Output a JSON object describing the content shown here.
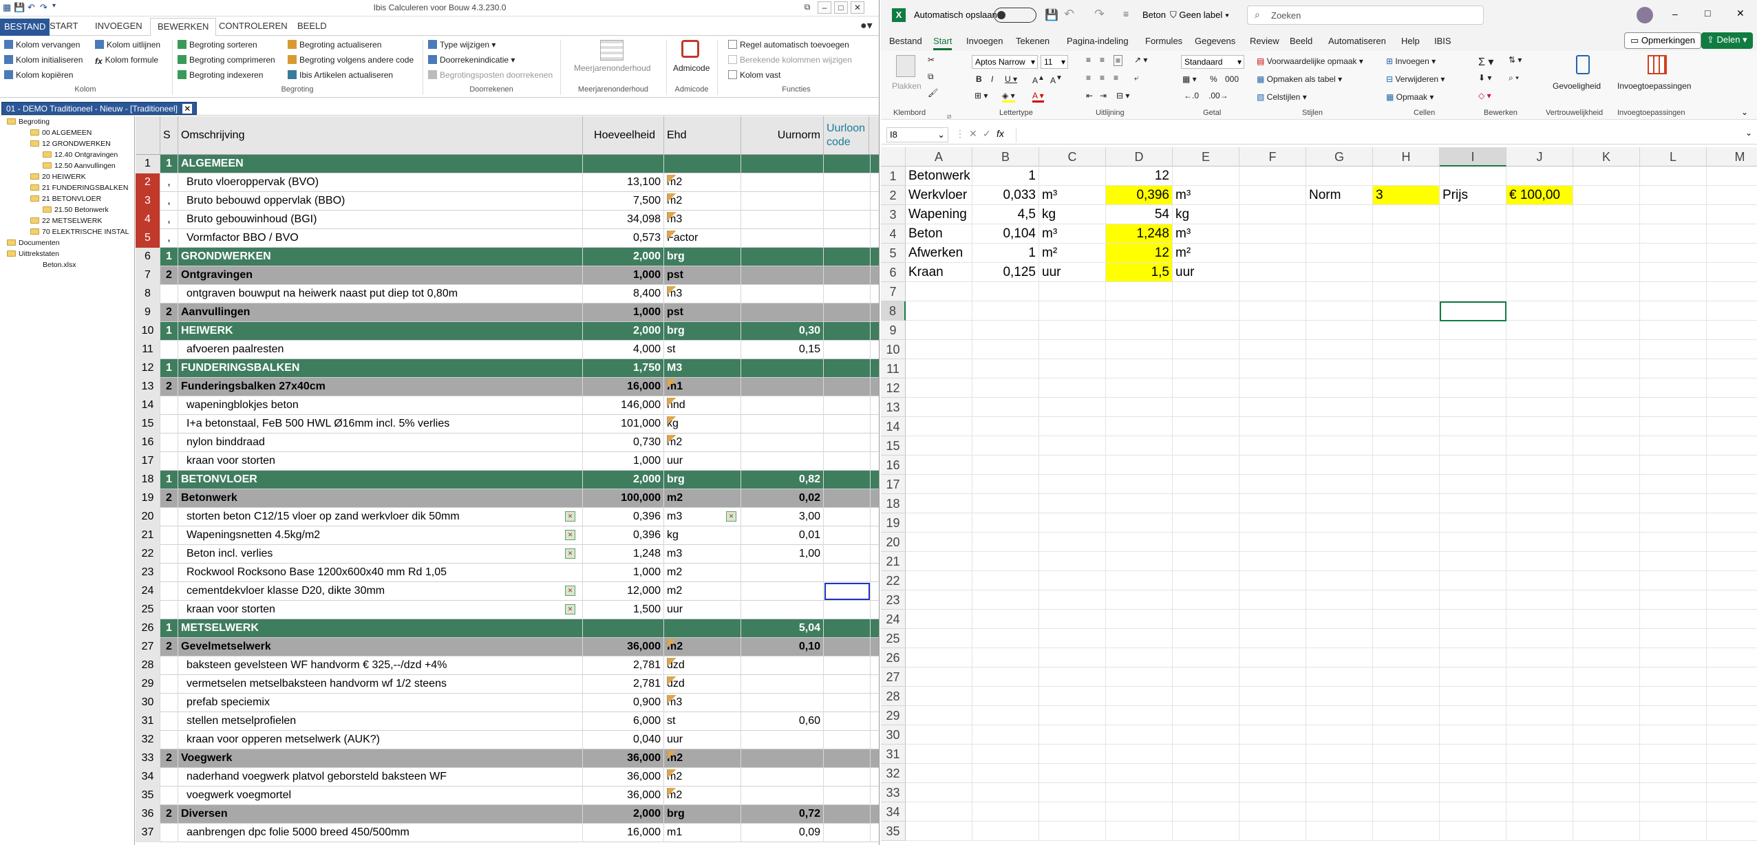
{
  "ibis": {
    "title": "Ibis Calculeren voor Bouw 4.3.230.0",
    "tabs": [
      "BESTAND",
      "START",
      "INVOEGEN",
      "BEWERKEN",
      "CONTROLEREN",
      "BEELD"
    ],
    "ribbon": {
      "kolom": [
        "Kolom vervangen",
        "Kolom initialiseren",
        "Kolom kopiëren",
        "Kolom uitlijnen",
        "Kolom formule"
      ],
      "begroting": [
        "Begroting sorteren",
        "Begroting comprimeren",
        "Begroting indexeren",
        "Begroting actualiseren",
        "Begroting volgens andere code",
        "Ibis Artikelen actualiseren"
      ],
      "doorrekenen": [
        "Type wijzigen",
        "Doorrekenindicatie",
        "Begrotingsposten doorrekenen"
      ],
      "meerjaren": "Meerjarenonderhoud",
      "admicode": "Admicode",
      "functies": [
        "Regel automatisch toevoegen",
        "Berekende kolommen wijzigen",
        "Kolom vast"
      ],
      "groups": [
        "Kolom",
        "Begroting",
        "Doorrekenen",
        "Meerjarenonderhoud",
        "Admicode",
        "Functies"
      ]
    },
    "doc_tab": "01 - DEMO Traditioneel - Nieuw - [Traditioneel]",
    "tree": [
      "Begroting",
      "00 ALGEMEEN",
      "12 GRONDWERKEN",
      "12.40 Ontgravingen",
      "12.50 Aanvullingen",
      "20 HEIWERK",
      "21 FUNDERINGSBALKEN",
      "21 BETONVLOER",
      "21.50 Betonwerk",
      "22 METSELWERK",
      "70 ELEKTRISCHE INSTAL",
      "Documenten",
      "Uittrekstaten",
      "Beton.xlsx"
    ],
    "columns": {
      "s": "S",
      "desc": "Omschrijving",
      "qty": "Hoeveelheid",
      "unit": "Ehd",
      "norm": "Uurnorm",
      "code": "Uurloon code"
    },
    "rows": [
      {
        "n": "1",
        "lvl": 1,
        "s": "1",
        "d": "ALGEMEEN",
        "q": "",
        "u": "",
        "nm": ""
      },
      {
        "n": "2",
        "lvl": 0,
        "red": true,
        "s": ",",
        "d": "Bruto vloeroppervak (BVO)",
        "q": "13,100",
        "u": "m2",
        "nm": "",
        "flag": true
      },
      {
        "n": "3",
        "lvl": 0,
        "red": true,
        "s": ",",
        "d": "Bruto bebouwd oppervlak (BBO)",
        "q": "7,500",
        "u": "m2",
        "nm": "",
        "flag": true
      },
      {
        "n": "4",
        "lvl": 0,
        "red": true,
        "s": ",",
        "d": "Bruto gebouwinhoud (BGI)",
        "q": "34,098",
        "u": "m3",
        "nm": "",
        "flag": true
      },
      {
        "n": "5",
        "lvl": 0,
        "red": true,
        "s": ",",
        "d": "Vormfactor BBO / BVO",
        "q": "0,573",
        "u": "Factor",
        "nm": "",
        "flag": true
      },
      {
        "n": "6",
        "lvl": 1,
        "s": "1",
        "d": "GRONDWERKEN",
        "q": "2,000",
        "u": "brg",
        "nm": ""
      },
      {
        "n": "7",
        "lvl": 2,
        "s": "2",
        "d": "Ontgravingen",
        "q": "1,000",
        "u": "pst",
        "nm": ""
      },
      {
        "n": "8",
        "lvl": 0,
        "s": "",
        "d": "ontgraven bouwput na heiwerk naast put diep tot 0,80m",
        "q": "8,400",
        "u": "m3",
        "nm": "",
        "flag": true
      },
      {
        "n": "9",
        "lvl": 2,
        "s": "2",
        "d": "Aanvullingen",
        "q": "1,000",
        "u": "pst",
        "nm": ""
      },
      {
        "n": "10",
        "lvl": 1,
        "s": "1",
        "d": "HEIWERK",
        "q": "2,000",
        "u": "brg",
        "nm": "0,30"
      },
      {
        "n": "11",
        "lvl": 0,
        "s": "",
        "d": "afvoeren paalresten",
        "q": "4,000",
        "u": "st",
        "nm": "0,15"
      },
      {
        "n": "12",
        "lvl": 1,
        "s": "1",
        "d": "FUNDERINGSBALKEN",
        "q": "1,750",
        "u": "M3",
        "nm": ""
      },
      {
        "n": "13",
        "lvl": 2,
        "s": "2",
        "d": "Funderingsbalken 27x40cm",
        "q": "16,000",
        "u": "m1",
        "nm": "",
        "flag": true
      },
      {
        "n": "14",
        "lvl": 0,
        "s": "",
        "d": "wapeningblokjes beton",
        "q": "146,000",
        "u": "hnd",
        "nm": "",
        "flag": true
      },
      {
        "n": "15",
        "lvl": 0,
        "s": "",
        "d": "I+a betonstaal, FeB 500 HWL Ø16mm incl. 5% verlies",
        "q": "101,000",
        "u": "kg",
        "nm": "",
        "flag": true
      },
      {
        "n": "16",
        "lvl": 0,
        "s": "",
        "d": "nylon binddraad",
        "q": "0,730",
        "u": "m2",
        "nm": "",
        "flag": true
      },
      {
        "n": "17",
        "lvl": 0,
        "s": "",
        "d": "kraan voor storten",
        "q": "1,000",
        "u": "uur",
        "nm": ""
      },
      {
        "n": "18",
        "lvl": 1,
        "s": "1",
        "d": "BETONVLOER",
        "q": "2,000",
        "u": "brg",
        "nm": "0,82"
      },
      {
        "n": "19",
        "lvl": 2,
        "s": "2",
        "d": "Betonwerk",
        "q": "100,000",
        "u": "m2",
        "nm": "0,02"
      },
      {
        "n": "20",
        "lvl": 0,
        "s": "",
        "d": "storten beton C12/15 vloer op zand werkvloer dik 50mm",
        "q": "0,396",
        "u": "m3",
        "nm": "3,00",
        "icon": true,
        "icon2": true
      },
      {
        "n": "21",
        "lvl": 0,
        "s": "",
        "d": "Wapeningsnetten 4.5kg/m2",
        "q": "0,396",
        "u": "kg",
        "nm": "0,01",
        "icon": true
      },
      {
        "n": "22",
        "lvl": 0,
        "s": "",
        "d": "Beton incl. verlies",
        "q": "1,248",
        "u": "m3",
        "nm": "1,00",
        "icon": true
      },
      {
        "n": "23",
        "lvl": 0,
        "s": "",
        "d": "Rockwool Rocksono Base 1200x600x40 mm Rd 1,05",
        "q": "1,000",
        "u": "m2",
        "nm": ""
      },
      {
        "n": "24",
        "lvl": 0,
        "s": "",
        "d": "cementdekvloer klasse D20, dikte 30mm",
        "q": "12,000",
        "u": "m2",
        "nm": "",
        "icon": true,
        "sel": true
      },
      {
        "n": "25",
        "lvl": 0,
        "s": "",
        "d": "kraan voor storten",
        "q": "1,500",
        "u": "uur",
        "nm": "",
        "icon": true
      },
      {
        "n": "26",
        "lvl": 1,
        "s": "1",
        "d": "METSELWERK",
        "q": "",
        "u": "",
        "nm": "5,04"
      },
      {
        "n": "27",
        "lvl": 2,
        "s": "2",
        "d": "Gevelmetselwerk",
        "q": "36,000",
        "u": "m2",
        "nm": "0,10",
        "flag": true
      },
      {
        "n": "28",
        "lvl": 0,
        "s": "",
        "d": "baksteen gevelsteen WF handvorm € 325,--/dzd +4%",
        "q": "2,781",
        "u": "dzd",
        "nm": "",
        "flag": true
      },
      {
        "n": "29",
        "lvl": 0,
        "s": "",
        "d": "vermetselen metselbaksteen handvorm wf 1/2 steens",
        "q": "2,781",
        "u": "dzd",
        "nm": "",
        "flag": true
      },
      {
        "n": "30",
        "lvl": 0,
        "s": "",
        "d": "prefab speciemix",
        "q": "0,900",
        "u": "m3",
        "nm": "",
        "flag": true
      },
      {
        "n": "31",
        "lvl": 0,
        "s": "",
        "d": "stellen metselprofielen",
        "q": "6,000",
        "u": "st",
        "nm": "0,60"
      },
      {
        "n": "32",
        "lvl": 0,
        "s": "",
        "d": "kraan voor opperen metselwerk (AUK?)",
        "q": "0,040",
        "u": "uur",
        "nm": ""
      },
      {
        "n": "33",
        "lvl": 2,
        "s": "2",
        "d": "Voegwerk",
        "q": "36,000",
        "u": "m2",
        "nm": "",
        "flag": true
      },
      {
        "n": "34",
        "lvl": 0,
        "s": "",
        "d": "naderhand voegwerk platvol geborsteld baksteen WF",
        "q": "36,000",
        "u": "m2",
        "nm": "",
        "flag": true
      },
      {
        "n": "35",
        "lvl": 0,
        "s": "",
        "d": "voegwerk voegmortel",
        "q": "36,000",
        "u": "m2",
        "nm": "",
        "flag": true
      },
      {
        "n": "36",
        "lvl": 2,
        "s": "2",
        "d": "Diversen",
        "q": "2,000",
        "u": "brg",
        "nm": "0,72"
      },
      {
        "n": "37",
        "lvl": 0,
        "s": "",
        "d": "aanbrengen dpc folie 5000 breed 450/500mm",
        "q": "16,000",
        "u": "m1",
        "nm": "0,09"
      }
    ]
  },
  "excel": {
    "autosave": "Automatisch opslaan",
    "docname": "Beton",
    "label": "Geen label",
    "search": "Zoeken",
    "tabs": [
      "Bestand",
      "Start",
      "Invoegen",
      "Tekenen",
      "Pagina-indeling",
      "Formules",
      "Gegevens",
      "Review",
      "Beeld",
      "Automatiseren",
      "Help",
      "IBIS"
    ],
    "comments": "Opmerkingen",
    "share": "Delen",
    "ribbon": {
      "paste": "Plakken",
      "font": "Aptos Narrow",
      "size": "11",
      "numfmt": "Standaard",
      "styles": [
        "Voorwaardelijke opmaak",
        "Opmaken als tabel",
        "Celstijlen"
      ],
      "cells": [
        "Invoegen",
        "Verwijderen",
        "Opmaak"
      ],
      "sens": "Gevoeligheid",
      "addins": "Invoegtoepassingen",
      "groups": [
        "Klembord",
        "Lettertype",
        "Uitlijning",
        "Getal",
        "Stijlen",
        "Cellen",
        "Bewerken",
        "Vertrouwelijkheid",
        "Invoegtoepassingen"
      ]
    },
    "namebox": "I8",
    "fx": "fx",
    "cols": [
      "A",
      "B",
      "C",
      "D",
      "E",
      "F",
      "G",
      "H",
      "I",
      "J",
      "K",
      "L",
      "M"
    ],
    "cells": [
      {
        "r": 1,
        "c": "A",
        "v": "Betonwerk"
      },
      {
        "r": 1,
        "c": "B",
        "v": "1",
        "al": "r"
      },
      {
        "r": 1,
        "c": "D",
        "v": "12",
        "al": "r"
      },
      {
        "r": 2,
        "c": "A",
        "v": "Werkvloer"
      },
      {
        "r": 2,
        "c": "B",
        "v": "0,033",
        "al": "r"
      },
      {
        "r": 2,
        "c": "C",
        "v": "m³"
      },
      {
        "r": 2,
        "c": "D",
        "v": "0,396",
        "al": "r",
        "y": true
      },
      {
        "r": 2,
        "c": "E",
        "v": "m³"
      },
      {
        "r": 2,
        "c": "G",
        "v": "Norm"
      },
      {
        "r": 2,
        "c": "H",
        "v": "3",
        "y": true
      },
      {
        "r": 2,
        "c": "I",
        "v": "Prijs"
      },
      {
        "r": 2,
        "c": "J",
        "v": "€ 100,00",
        "y": true
      },
      {
        "r": 3,
        "c": "A",
        "v": "Wapening"
      },
      {
        "r": 3,
        "c": "B",
        "v": "4,5",
        "al": "r"
      },
      {
        "r": 3,
        "c": "C",
        "v": "kg"
      },
      {
        "r": 3,
        "c": "D",
        "v": "54",
        "al": "r"
      },
      {
        "r": 3,
        "c": "E",
        "v": "kg"
      },
      {
        "r": 4,
        "c": "A",
        "v": "Beton"
      },
      {
        "r": 4,
        "c": "B",
        "v": "0,104",
        "al": "r"
      },
      {
        "r": 4,
        "c": "C",
        "v": "m³"
      },
      {
        "r": 4,
        "c": "D",
        "v": "1,248",
        "al": "r",
        "y": true
      },
      {
        "r": 4,
        "c": "E",
        "v": "m³"
      },
      {
        "r": 5,
        "c": "A",
        "v": "Afwerken"
      },
      {
        "r": 5,
        "c": "B",
        "v": "1",
        "al": "r"
      },
      {
        "r": 5,
        "c": "C",
        "v": "m²"
      },
      {
        "r": 5,
        "c": "D",
        "v": "12",
        "al": "r",
        "y": true
      },
      {
        "r": 5,
        "c": "E",
        "v": "m²"
      },
      {
        "r": 6,
        "c": "A",
        "v": "Kraan"
      },
      {
        "r": 6,
        "c": "B",
        "v": "0,125",
        "al": "r"
      },
      {
        "r": 6,
        "c": "C",
        "v": "uur"
      },
      {
        "r": 6,
        "c": "D",
        "v": "1,5",
        "al": "r",
        "y": true
      },
      {
        "r": 6,
        "c": "E",
        "v": "uur"
      }
    ],
    "rows": 35
  }
}
